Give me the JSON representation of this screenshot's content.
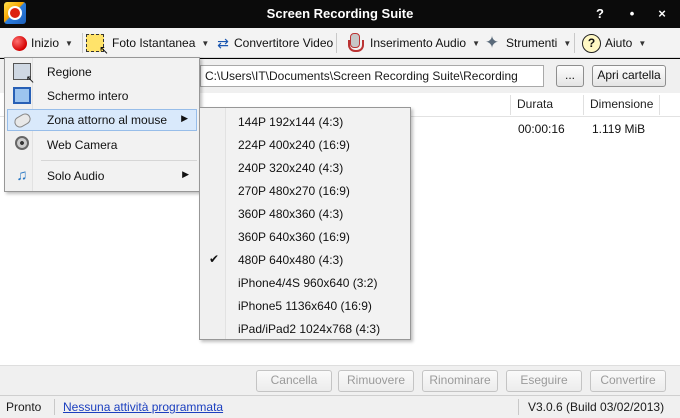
{
  "window": {
    "title": "Screen Recording Suite",
    "help_btn": "?",
    "minimize_btn": "•",
    "close_btn": "×"
  },
  "toolbar": {
    "start": "Inizio",
    "snapshot": "Foto Istantanea",
    "converter": "Convertitore Video",
    "audio": "Inserimento Audio",
    "tools": "Strumenti",
    "help": "Aiuto",
    "arrow": "▼"
  },
  "path": {
    "value": "C:\\Users\\IT\\Documents\\Screen Recording Suite\\Recording",
    "browse_label": "...",
    "open_folder_label": "Apri cartella"
  },
  "table": {
    "columns": {
      "duration": "Durata",
      "size": "Dimensione"
    },
    "rows": [
      {
        "duration": "00:00:16",
        "size": "1.119 MiB"
      }
    ]
  },
  "start_menu": {
    "items": [
      {
        "label": "Regione"
      },
      {
        "label": "Schermo intero"
      },
      {
        "label": "Zona attorno al mouse",
        "submenu_arrow": "▶"
      },
      {
        "label": "Web Camera"
      },
      {
        "label": "Solo Audio",
        "submenu_arrow": "▶"
      }
    ]
  },
  "resolution_menu": {
    "check_mark": "✔",
    "items": [
      {
        "label": "144P 192x144 (4:3)"
      },
      {
        "label": "224P 400x240 (16:9)"
      },
      {
        "label": "240P 320x240 (4:3)"
      },
      {
        "label": "270P 480x270 (16:9)"
      },
      {
        "label": "360P 480x360 (4:3)"
      },
      {
        "label": "360P 640x360 (16:9)"
      },
      {
        "label": "480P 640x480 (4:3)",
        "checked": true
      },
      {
        "label": "iPhone4/4S 960x640 (3:2)"
      },
      {
        "label": "iPhone5 1136x640 (16:9)"
      },
      {
        "label": "iPad/iPad2 1024x768 (4:3)"
      }
    ]
  },
  "actions": {
    "cancel": "Cancella",
    "remove": "Rimuovere",
    "rename": "Rinominare",
    "execute": "Eseguire",
    "convert": "Convertire"
  },
  "status": {
    "state": "Pronto",
    "schedule_link": "Nessuna attività programmata",
    "version": "V3.0.6 (Build 03/02/2013)"
  }
}
